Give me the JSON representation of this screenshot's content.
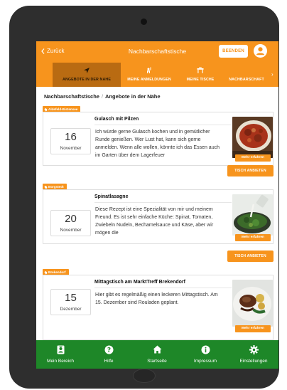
{
  "topbar": {
    "back_label": "Zurück",
    "title": "Nachbarschaftstische",
    "end_label": "BEENDEN"
  },
  "tabs": [
    {
      "label": "ANGEBOTE IN DER NÄHE",
      "icon": "location-arrow-icon",
      "active": true
    },
    {
      "label": "MEINE ANMELDUNGEN",
      "icon": "person-raising-hand-icon",
      "active": false
    },
    {
      "label": "MEINE TISCHE",
      "icon": "table-icon",
      "active": false
    },
    {
      "label": "NACHBARSCHAFT",
      "icon": "neighborhood-icon",
      "active": false
    }
  ],
  "breadcrumb": {
    "root": "Nachbarschaftstische",
    "separator": "/",
    "current": "Angebote in der Nähe"
  },
  "offers": [
    {
      "location": "Aldefeld-Bistensee",
      "day": "16",
      "month": "November",
      "title": "Gulasch mit Pilzen",
      "text": "Ich würde gerne Gulasch kochen und in gemütlicher Runde genießen. Wer Lust hat, kann sich gerne anmelden. Wenn alle wollen, könnte ich das Essen auch im Garten über dem Lagerfeuer",
      "more_label": "Mehr erfahren",
      "offer_label": "TISCH ANBIETEN"
    },
    {
      "location": "Borgstedt",
      "day": "20",
      "month": "November",
      "title": "Spinatlasagne",
      "text": "Diese Rezept ist eine Spezialität von mir und meinem Freund. Es ist sehr einfache Küche: Spinat, Tomaten, Zwiebeln Nudeln, Bechamelsauce und Käse, aber wir mögen die",
      "more_label": "Mehr erfahren",
      "offer_label": "TISCH ANBIETEN"
    },
    {
      "location": "Brekendorf",
      "day": "15",
      "month": "Dezember",
      "title": "Mittagstisch am MarktTreff Brekendorf",
      "text": "Hier gibt es regelmäßig einen leckeren Mittagstisch. Am 15. Dezember sind Rouladen geplant.",
      "more_label": "Mehr erfahren"
    }
  ],
  "bottom_nav": [
    {
      "label": "Mein Bereich",
      "icon": "id-badge-icon"
    },
    {
      "label": "Hilfe",
      "icon": "help-icon"
    },
    {
      "label": "Startseite",
      "icon": "home-icon"
    },
    {
      "label": "Impressum",
      "icon": "info-icon"
    },
    {
      "label": "Einstellungen",
      "icon": "gear-icon"
    }
  ],
  "colors": {
    "primary": "#f7941d",
    "tab_active": "#b96b12",
    "bottom_nav": "#1e8728"
  }
}
